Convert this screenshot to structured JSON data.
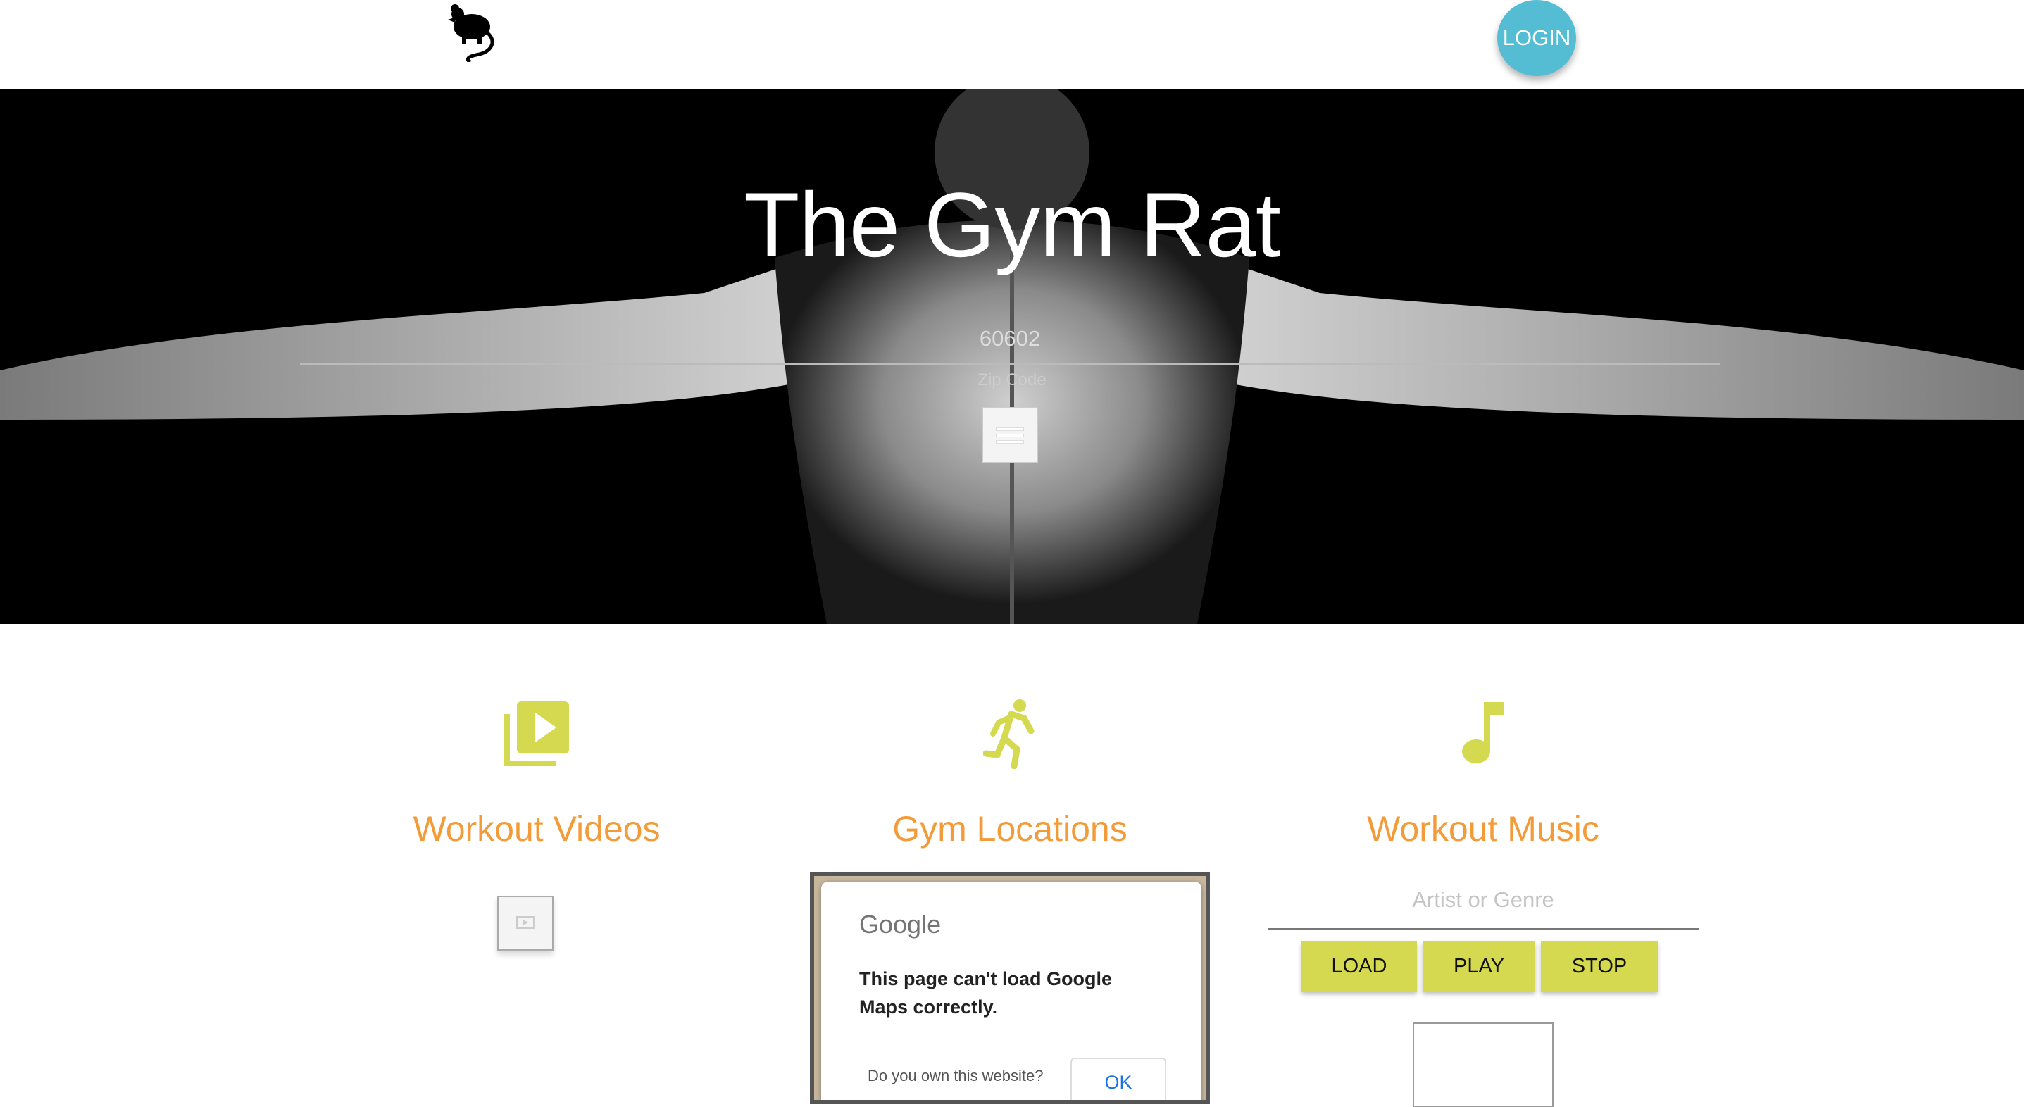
{
  "header": {
    "logo_icon": "rat-icon",
    "login_label": "LOGIN",
    "login_color": "#55bdd3"
  },
  "hero": {
    "title": "The Gym Rat",
    "zip_value": "60602",
    "zip_label": "Zip Code",
    "menu_icon": "hamburger-icon"
  },
  "features": [
    {
      "icon": "video-library-icon",
      "title": "Workout Videos"
    },
    {
      "icon": "running-person-icon",
      "title": "Gym Locations"
    },
    {
      "icon": "music-note-icon",
      "title": "Workout Music"
    }
  ],
  "map_error": {
    "brand": "Google",
    "message": "This page can't load Google Maps correctly.",
    "question": "Do you own this website?",
    "ok_label": "OK"
  },
  "music": {
    "placeholder": "Artist or Genre",
    "load_label": "LOAD",
    "play_label": "PLAY",
    "stop_label": "STOP"
  },
  "colors": {
    "accent_green": "#d4d94f",
    "heading_orange": "#f29b38",
    "icon_green": "#d4d94f"
  }
}
